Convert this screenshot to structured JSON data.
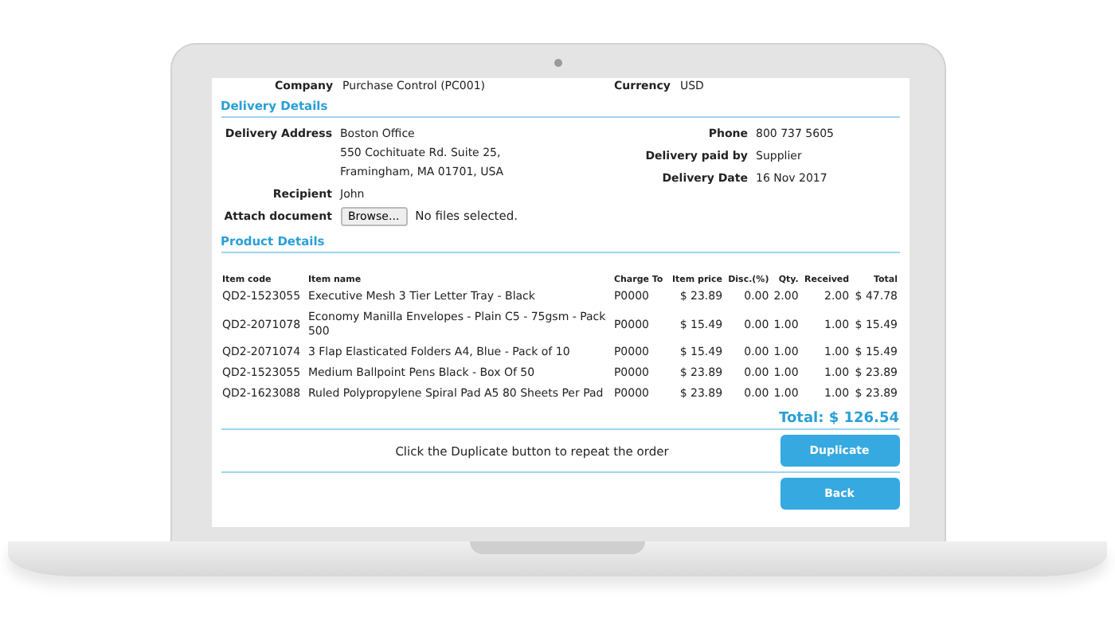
{
  "summary_row": [
    {
      "label": "Company",
      "value": "Purchase Control (PC001)"
    },
    {
      "label": "Currency",
      "value": "USD"
    }
  ],
  "delivery_details": {
    "title": "Delivery Details",
    "left_fields": [
      {
        "label": "Delivery Address",
        "lines": [
          "Boston Office",
          "550 Cochituate Rd. Suite 25,",
          "Framingham, MA 01701, USA"
        ]
      },
      {
        "label": "Recipient",
        "lines": [
          "John"
        ]
      }
    ],
    "right_fields": [
      {
        "label": "Phone",
        "value": "800 737 5605"
      },
      {
        "label": "Delivery paid by",
        "value": "Supplier"
      },
      {
        "label": "Delivery Date",
        "value": "16 Nov 2017"
      }
    ],
    "attach": {
      "label": "Attach document",
      "button": "Browse...",
      "status": "No files selected."
    }
  },
  "product_details": {
    "title": "Product Details",
    "columns": [
      "Item code",
      "Item name",
      "Charge To",
      "Item price",
      "Disc.(%)",
      "Qty.",
      "Received",
      "Total"
    ],
    "rows": [
      [
        "QD2-1523055",
        "Executive Mesh 3 Tier Letter Tray - Black",
        "P0000",
        "$ 23.89",
        "0.00",
        "2.00",
        "2.00",
        "$ 47.78"
      ],
      [
        "QD2-2071078",
        "Economy Manilla Envelopes - Plain C5 - 75gsm - Pack 500",
        "P0000",
        "$ 15.49",
        "0.00",
        "1.00",
        "1.00",
        "$ 15.49"
      ],
      [
        "QD2-2071074",
        "3 Flap Elasticated Folders A4, Blue - Pack of 10",
        "P0000",
        "$ 15.49",
        "0.00",
        "1.00",
        "1.00",
        "$ 15.49"
      ],
      [
        "QD2-1523055",
        "Medium Ballpoint Pens Black - Box Of 50",
        "P0000",
        "$ 23.89",
        "0.00",
        "1.00",
        "1.00",
        "$ 23.89"
      ],
      [
        "QD2-1623088",
        "Ruled Polypropylene Spiral Pad A5 80 Sheets Per Pad",
        "P0000",
        "$ 23.89",
        "0.00",
        "1.00",
        "1.00",
        "$ 23.89"
      ]
    ],
    "total": "Total: $ 126.54"
  },
  "duplicate_note": "Click the Duplicate button to repeat the order",
  "buttons": {
    "duplicate": "Duplicate",
    "back": "Back"
  }
}
